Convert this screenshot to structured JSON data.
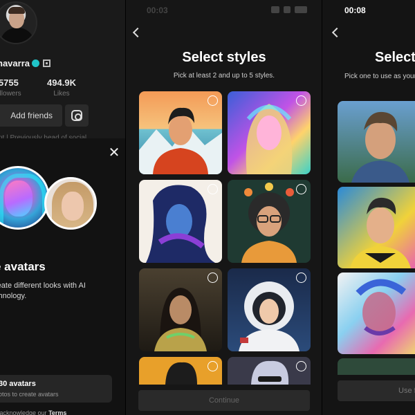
{
  "profile": {
    "username": "navarra",
    "stats": [
      {
        "value": "5755",
        "label": "ollowers"
      },
      {
        "value": "494.9K",
        "label": "Likes"
      }
    ],
    "add_friends_label": "Add friends",
    "bio": "nt | Previously head of social"
  },
  "avatar_sheet": {
    "title": "e avatars",
    "description": "reate different looks with AI chnology.",
    "plan_title": "30 avatars",
    "plan_subtitle": "otos to create avatars",
    "terms_text": "u acknowledge our ",
    "terms_link": "Terms"
  },
  "select_styles": {
    "status_time": "00:03",
    "title": "Select styles",
    "subtitle": "Pick at least 2 and up to 5 styles.",
    "continue_label": "Continue",
    "styles": [
      {
        "name": "illustrated-mountain-style"
      },
      {
        "name": "holographic-style"
      },
      {
        "name": "watercolor-ink-style"
      },
      {
        "name": "floral-retro-style"
      },
      {
        "name": "golden-armor-style"
      },
      {
        "name": "astronaut-style"
      },
      {
        "name": "orange-pop-style"
      },
      {
        "name": "silver-hair-style"
      }
    ]
  },
  "third_screen": {
    "status_time": "00:08",
    "title": "Select",
    "subtitle": "Pick one to use as your pr to yo",
    "use_label": "Use f"
  },
  "colors": {
    "background": "#121212",
    "card_button": "#2a2a2a",
    "verified": "#20c4c8"
  }
}
